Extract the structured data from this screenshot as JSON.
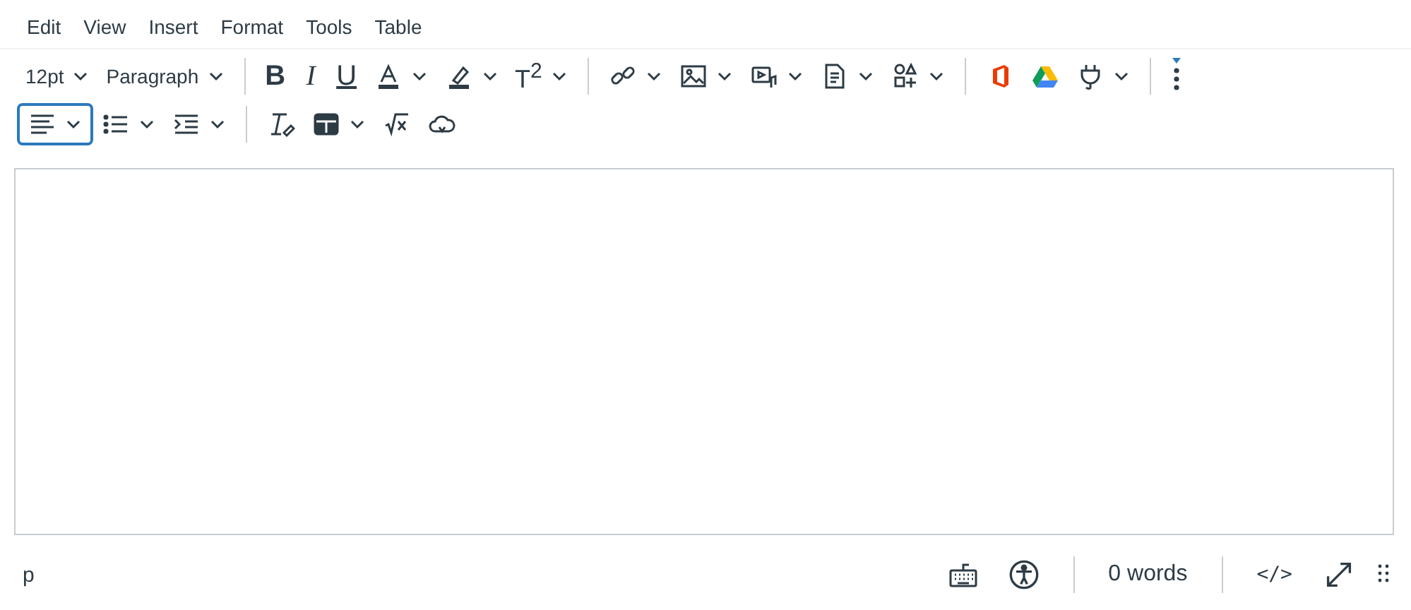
{
  "menu_bar": [
    "Edit",
    "View",
    "Insert",
    "Format",
    "Tools",
    "Table"
  ],
  "toolbar": {
    "font_size": "12pt",
    "block_format": "Paragraph",
    "bold": "B",
    "italic": "I",
    "underline": "U",
    "superscript": "T$^{2}$",
    "alignment": {
      "selected": true
    }
  },
  "status_bar": {
    "element_path": "p",
    "word_count": "0 words",
    "html_toggle": "</>"
  }
}
